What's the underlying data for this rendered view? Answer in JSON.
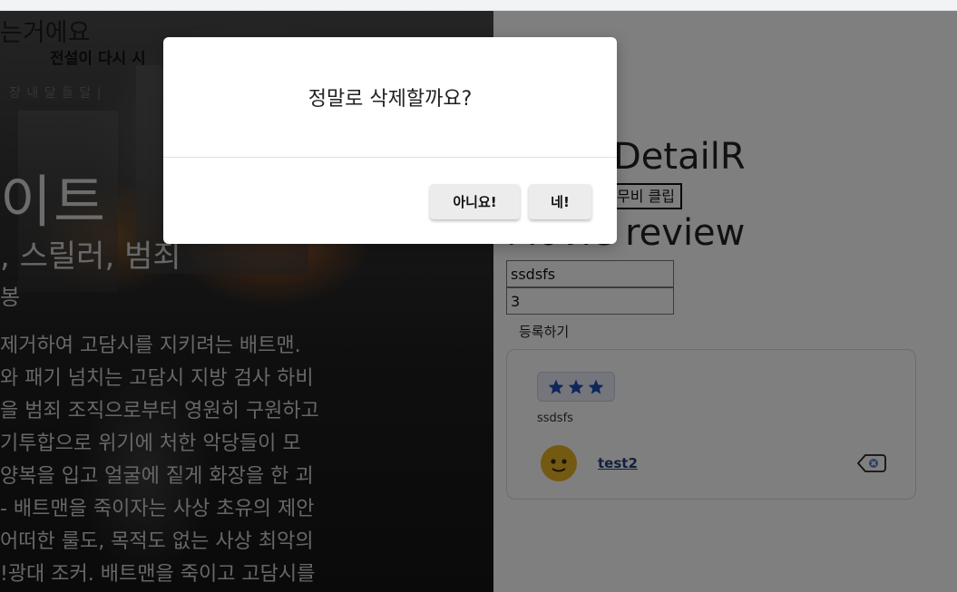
{
  "poster": {
    "tagline": "는거에요",
    "subtitle": "전설이 다시 시",
    "small_text": "장 내 달 들 달 |",
    "title": "이트",
    "genre": ", 스릴러, 범죄",
    "director": "봉",
    "synopsis": [
      "제거하여 고담시를 지키려는 배트맨.",
      "와 패기 넘치는 고담시 지방 검사 하비",
      "을 범죄 조직으로부터 영원히 구원하고",
      "기투합으로 위기에 처한 악당들이 모",
      "양복을 입고 얼굴에 짙게 화장을 한 괴",
      "- 배트맨을 죽이자는 사상 초유의 제안",
      "어떠한 룰도, 목적도 없는 사상 최악의",
      "!광대 조커. 배트맨을 죽이고 고담시를"
    ]
  },
  "detail": {
    "title": "DetailR",
    "clip_button": "무비 클립",
    "review_heading": "Movie review",
    "input_content_value": "ssdsfs",
    "input_rating_value": "3",
    "submit_label": "등록하기"
  },
  "review_card": {
    "rating": 3,
    "content": "ssdsfs",
    "username": "test2",
    "star_color": "#1f4fb5",
    "avatar_color": "#e6b325"
  },
  "modal": {
    "message": "정말로 삭제할까요?",
    "no_label": "아니요!",
    "yes_label": "네!"
  }
}
